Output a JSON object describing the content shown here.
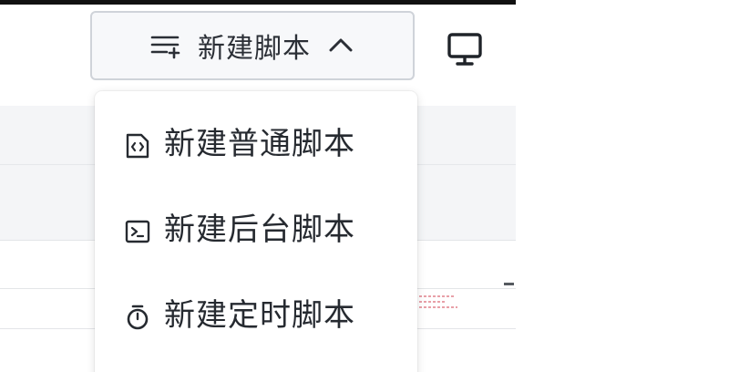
{
  "toolbar": {
    "new_script_label": "新建脚本"
  },
  "dropdown": {
    "items": [
      {
        "label": "新建普通脚本",
        "icon": "code-file-icon"
      },
      {
        "label": "新建后台脚本",
        "icon": "terminal-icon"
      },
      {
        "label": "新建定时脚本",
        "icon": "timer-icon"
      }
    ]
  },
  "colors": {
    "text": "#262a30",
    "button_border": "#cfd3d9",
    "table_bg": "#f4f5f7"
  }
}
